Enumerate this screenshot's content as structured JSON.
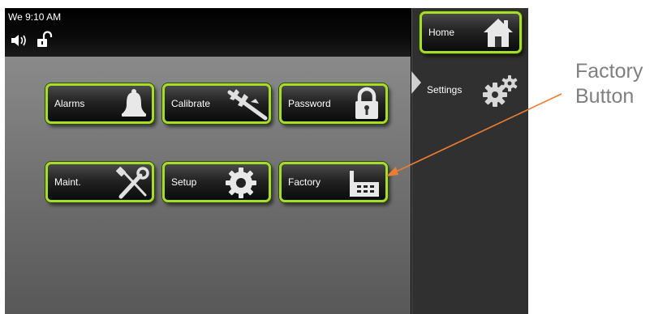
{
  "status_bar": {
    "datetime": "We  9:10 AM",
    "icons": [
      "speaker-icon",
      "unlock-icon"
    ]
  },
  "buttons": {
    "alarms": "Alarms",
    "calibrate": "Calibrate",
    "password": "Password",
    "maint": "Maint.",
    "setup": "Setup",
    "factory": "Factory"
  },
  "sidebar": {
    "home_label": "Home",
    "settings_label": "Settings"
  },
  "annotation": {
    "line1": "Factory",
    "line2": "Button",
    "color": "#7f7f7f",
    "arrow_color": "#ed7d31"
  },
  "colors": {
    "button_border": "#a6dc2a",
    "background_gray": "#6d6d6d",
    "sidebar_bg": "#303030"
  }
}
